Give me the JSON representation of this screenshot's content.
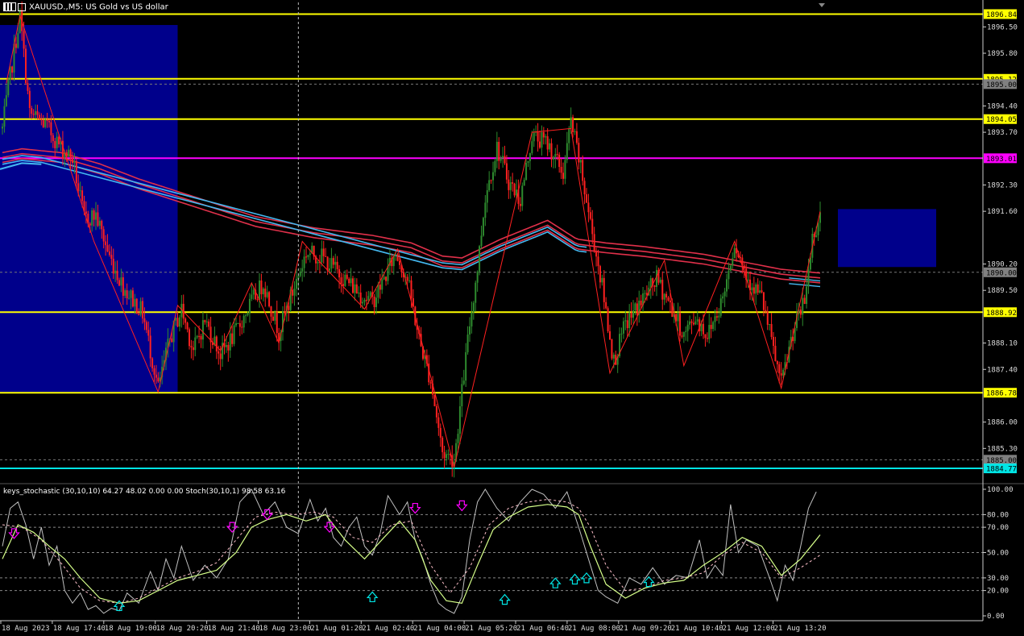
{
  "window": {
    "title": "XAUUSD.,M5:  US Gold vs US dollar"
  },
  "indicator": {
    "title": "keys_stochastic (30,10,10) 64.27 48.02 0.00 0.00 Stoch(30,10,1) 98.58 63.16"
  },
  "colors": {
    "background": "#000000",
    "bull": "#2E8B2E",
    "bear": "#FF2020",
    "zigzag": "#FF2020",
    "ma_red": "#E0304A",
    "ma_blue": "#44B8F0",
    "level_yellow": "#FFFF00",
    "level_magenta": "#FF00FF",
    "level_cyan": "#00E5E5",
    "zone_blue": "#00008B",
    "stoch_main": "#C0C0C0",
    "stoch_signal": "#FFC0CB",
    "stoch_keys": "#D6FF8A",
    "arrow_down": "#FF00FF",
    "arrow_up": "#00E5E5"
  },
  "chart_data": {
    "type": "candlestick",
    "symbol": "XAUUSD.",
    "timeframe": "M5",
    "grid": false,
    "y_ticks": [
      "1896.50",
      "1895.80",
      "1894.40",
      "1893.70",
      "1892.30",
      "1891.60",
      "1890.20",
      "1889.50",
      "1888.10",
      "1887.40",
      "1886.00",
      "1885.30"
    ],
    "ylim": [
      1884.45,
      1897.15
    ],
    "x_ticks": [
      "18 Aug 2023",
      "18 Aug 17:40",
      "18 Aug 19:00",
      "18 Aug 20:20",
      "18 Aug 21:40",
      "18 Aug 23:00",
      "21 Aug 01:20",
      "21 Aug 02:40",
      "21 Aug 04:00",
      "21 Aug 05:20",
      "21 Aug 06:40",
      "21 Aug 08:00",
      "21 Aug 09:20",
      "21 Aug 10:40",
      "21 Aug 12:00",
      "21 Aug 13:20"
    ],
    "price_labels": [
      {
        "text": "1896.84",
        "value": 1896.84,
        "style": "yellow"
      },
      {
        "text": "1895.12",
        "value": 1895.12,
        "style": "yellow"
      },
      {
        "text": "1895.00",
        "value": 1894.98,
        "style": "gray"
      },
      {
        "text": "1894.05",
        "value": 1894.05,
        "style": "yellow"
      },
      {
        "text": "1893.01",
        "value": 1893.01,
        "style": "magenta"
      },
      {
        "text": "1890.00",
        "value": 1889.98,
        "style": "gray"
      },
      {
        "text": "1888.92",
        "value": 1888.92,
        "style": "yellow"
      },
      {
        "text": "1886.78",
        "value": 1886.78,
        "style": "yellow"
      },
      {
        "text": "1885.00",
        "value": 1885.0,
        "style": "gray"
      },
      {
        "text": "1884.77",
        "value": 1884.77,
        "style": "cyan"
      }
    ],
    "horizontal_levels": [
      {
        "value": 1896.84,
        "color": "yellow"
      },
      {
        "value": 1895.12,
        "color": "yellow"
      },
      {
        "value": 1894.05,
        "color": "yellow"
      },
      {
        "value": 1893.01,
        "color": "magenta"
      },
      {
        "value": 1888.92,
        "color": "yellow"
      },
      {
        "value": 1886.78,
        "color": "yellow"
      },
      {
        "value": 1884.77,
        "color": "cyan"
      }
    ],
    "dashed_levels": [
      1894.98,
      1889.98,
      1885.0
    ],
    "zones": [
      {
        "x_start": 0,
        "x_end": 90,
        "y_top": 1896.55,
        "y_bottom": 1886.78
      },
      {
        "x_start": 425,
        "x_end": 510,
        "y_top": 1891.66,
        "y_bottom": 1890.12
      }
    ],
    "vertical_marker_bar": 152,
    "last_bar": 420,
    "anchors": [
      [
        0,
        1893.8
      ],
      [
        4,
        1895.2
      ],
      [
        9,
        1896.8
      ],
      [
        14,
        1894.2
      ],
      [
        22,
        1893.9
      ],
      [
        30,
        1893.3
      ],
      [
        36,
        1893.0
      ],
      [
        42,
        1891.4
      ],
      [
        48,
        1891.5
      ],
      [
        55,
        1890.4
      ],
      [
        62,
        1889.6
      ],
      [
        72,
        1888.9
      ],
      [
        80,
        1886.9
      ],
      [
        86,
        1888.2
      ],
      [
        92,
        1889.0
      ],
      [
        98,
        1887.9
      ],
      [
        104,
        1888.7
      ],
      [
        112,
        1887.8
      ],
      [
        120,
        1888.4
      ],
      [
        128,
        1889.2
      ],
      [
        134,
        1889.7
      ],
      [
        142,
        1888.4
      ],
      [
        150,
        1889.6
      ],
      [
        156,
        1890.5
      ],
      [
        164,
        1890.4
      ],
      [
        170,
        1890.1
      ],
      [
        176,
        1889.8
      ],
      [
        184,
        1889.4
      ],
      [
        190,
        1889.2
      ],
      [
        196,
        1889.8
      ],
      [
        202,
        1890.5
      ],
      [
        208,
        1889.8
      ],
      [
        214,
        1888.2
      ],
      [
        220,
        1887.1
      ],
      [
        226,
        1885.2
      ],
      [
        232,
        1885.0
      ],
      [
        236,
        1886.8
      ],
      [
        240,
        1888.6
      ],
      [
        244,
        1890.1
      ],
      [
        248,
        1892.0
      ],
      [
        254,
        1893.3
      ],
      [
        260,
        1892.4
      ],
      [
        266,
        1891.9
      ],
      [
        272,
        1893.6
      ],
      [
        280,
        1893.4
      ],
      [
        288,
        1892.6
      ],
      [
        292,
        1894.0
      ],
      [
        296,
        1893.0
      ],
      [
        302,
        1891.3
      ],
      [
        308,
        1889.6
      ],
      [
        314,
        1887.6
      ],
      [
        320,
        1888.6
      ],
      [
        328,
        1889.2
      ],
      [
        336,
        1889.8
      ],
      [
        344,
        1889.0
      ],
      [
        350,
        1888.3
      ],
      [
        356,
        1888.8
      ],
      [
        362,
        1888.3
      ],
      [
        370,
        1889.3
      ],
      [
        376,
        1890.8
      ],
      [
        382,
        1889.9
      ],
      [
        390,
        1889.3
      ],
      [
        396,
        1887.9
      ],
      [
        400,
        1887.0
      ],
      [
        406,
        1888.4
      ],
      [
        412,
        1889.2
      ],
      [
        416,
        1890.9
      ],
      [
        420,
        1891.5
      ]
    ],
    "zigzag": [
      [
        2,
        1895.0
      ],
      [
        9,
        1896.8
      ],
      [
        47,
        1890.8
      ],
      [
        80,
        1886.8
      ],
      [
        90,
        1889.1
      ],
      [
        112,
        1887.9
      ],
      [
        128,
        1889.7
      ],
      [
        142,
        1888.1
      ],
      [
        154,
        1890.8
      ],
      [
        164,
        1890.2
      ],
      [
        186,
        1889.0
      ],
      [
        203,
        1890.6
      ],
      [
        232,
        1884.8
      ],
      [
        272,
        1893.7
      ],
      [
        292,
        1893.8
      ],
      [
        312,
        1887.3
      ],
      [
        340,
        1890.3
      ],
      [
        350,
        1887.5
      ],
      [
        376,
        1890.8
      ],
      [
        400,
        1886.9
      ],
      [
        420,
        1891.6
      ]
    ],
    "moving_averages": [
      {
        "color": "red",
        "offset": 0.0
      },
      {
        "color": "red",
        "offset": 0.13
      },
      {
        "color": "red",
        "offset": 0.26
      },
      {
        "color": "blue",
        "offset": -0.05
      },
      {
        "color": "blue",
        "offset": 0.08
      }
    ],
    "ma_anchors": [
      [
        0,
        1892.9
      ],
      [
        10,
        1893.0
      ],
      [
        30,
        1892.9
      ],
      [
        50,
        1892.6
      ],
      [
        70,
        1892.2
      ],
      [
        100,
        1891.7
      ],
      [
        130,
        1891.2
      ],
      [
        160,
        1890.9
      ],
      [
        190,
        1890.7
      ],
      [
        210,
        1890.5
      ],
      [
        226,
        1890.15
      ],
      [
        236,
        1890.1
      ],
      [
        256,
        1890.6
      ],
      [
        280,
        1891.1
      ],
      [
        295,
        1890.6
      ],
      [
        310,
        1890.5
      ],
      [
        330,
        1890.4
      ],
      [
        360,
        1890.2
      ],
      [
        380,
        1890.0
      ],
      [
        400,
        1889.8
      ],
      [
        420,
        1889.7
      ]
    ],
    "indicator_chart": {
      "type": "line",
      "ylim": [
        0,
        100
      ],
      "y_ticks": [
        "100.00",
        "80.00",
        "70.00",
        "50.00",
        "30.00",
        "20.00",
        "0.00"
      ],
      "levels": [
        80,
        70,
        50,
        30,
        20
      ],
      "stoch_main": [
        [
          0,
          55
        ],
        [
          4,
          85
        ],
        [
          8,
          90
        ],
        [
          12,
          72
        ],
        [
          16,
          45
        ],
        [
          20,
          70
        ],
        [
          24,
          40
        ],
        [
          28,
          55
        ],
        [
          32,
          20
        ],
        [
          36,
          10
        ],
        [
          40,
          18
        ],
        [
          44,
          5
        ],
        [
          48,
          8
        ],
        [
          52,
          2
        ],
        [
          56,
          6
        ],
        [
          60,
          4
        ],
        [
          64,
          18
        ],
        [
          70,
          10
        ],
        [
          76,
          35
        ],
        [
          80,
          20
        ],
        [
          84,
          45
        ],
        [
          88,
          30
        ],
        [
          92,
          55
        ],
        [
          98,
          28
        ],
        [
          104,
          40
        ],
        [
          110,
          30
        ],
        [
          116,
          45
        ],
        [
          122,
          90
        ],
        [
          128,
          100
        ],
        [
          134,
          80
        ],
        [
          140,
          90
        ],
        [
          146,
          70
        ],
        [
          152,
          65
        ],
        [
          158,
          92
        ],
        [
          162,
          75
        ],
        [
          166,
          85
        ],
        [
          170,
          62
        ],
        [
          174,
          55
        ],
        [
          178,
          70
        ],
        [
          182,
          78
        ],
        [
          186,
          55
        ],
        [
          190,
          48
        ],
        [
          194,
          65
        ],
        [
          198,
          95
        ],
        [
          204,
          80
        ],
        [
          208,
          90
        ],
        [
          212,
          60
        ],
        [
          216,
          45
        ],
        [
          220,
          25
        ],
        [
          224,
          10
        ],
        [
          228,
          5
        ],
        [
          232,
          2
        ],
        [
          236,
          15
        ],
        [
          240,
          60
        ],
        [
          244,
          90
        ],
        [
          248,
          100
        ],
        [
          254,
          85
        ],
        [
          260,
          75
        ],
        [
          266,
          90
        ],
        [
          272,
          100
        ],
        [
          278,
          96
        ],
        [
          284,
          85
        ],
        [
          290,
          98
        ],
        [
          296,
          70
        ],
        [
          302,
          40
        ],
        [
          306,
          20
        ],
        [
          310,
          15
        ],
        [
          316,
          10
        ],
        [
          322,
          30
        ],
        [
          328,
          25
        ],
        [
          334,
          38
        ],
        [
          340,
          25
        ],
        [
          346,
          32
        ],
        [
          352,
          30
        ],
        [
          358,
          60
        ],
        [
          362,
          30
        ],
        [
          366,
          40
        ],
        [
          370,
          32
        ],
        [
          374,
          88
        ],
        [
          378,
          50
        ],
        [
          382,
          60
        ],
        [
          388,
          55
        ],
        [
          394,
          30
        ],
        [
          398,
          12
        ],
        [
          402,
          40
        ],
        [
          406,
          28
        ],
        [
          410,
          55
        ],
        [
          414,
          85
        ],
        [
          418,
          98
        ]
      ],
      "stoch_signal": [
        [
          0,
          72
        ],
        [
          10,
          70
        ],
        [
          20,
          60
        ],
        [
          30,
          42
        ],
        [
          40,
          22
        ],
        [
          50,
          12
        ],
        [
          60,
          10
        ],
        [
          70,
          14
        ],
        [
          80,
          22
        ],
        [
          90,
          30
        ],
        [
          100,
          35
        ],
        [
          110,
          42
        ],
        [
          120,
          60
        ],
        [
          130,
          78
        ],
        [
          140,
          82
        ],
        [
          150,
          80
        ],
        [
          160,
          82
        ],
        [
          170,
          78
        ],
        [
          180,
          62
        ],
        [
          190,
          58
        ],
        [
          200,
          72
        ],
        [
          210,
          75
        ],
        [
          220,
          40
        ],
        [
          230,
          18
        ],
        [
          240,
          38
        ],
        [
          250,
          72
        ],
        [
          260,
          85
        ],
        [
          270,
          90
        ],
        [
          280,
          92
        ],
        [
          290,
          90
        ],
        [
          296,
          85
        ],
        [
          302,
          70
        ],
        [
          310,
          40
        ],
        [
          320,
          20
        ],
        [
          330,
          22
        ],
        [
          340,
          28
        ],
        [
          350,
          30
        ],
        [
          360,
          34
        ],
        [
          370,
          48
        ],
        [
          380,
          58
        ],
        [
          390,
          50
        ],
        [
          400,
          30
        ],
        [
          410,
          38
        ],
        [
          420,
          48
        ]
      ],
      "stoch_keys": [
        [
          0,
          45
        ],
        [
          8,
          72
        ],
        [
          16,
          66
        ],
        [
          24,
          55
        ],
        [
          32,
          45
        ],
        [
          40,
          30
        ],
        [
          50,
          14
        ],
        [
          60,
          10
        ],
        [
          70,
          12
        ],
        [
          80,
          20
        ],
        [
          90,
          28
        ],
        [
          100,
          32
        ],
        [
          110,
          36
        ],
        [
          120,
          50
        ],
        [
          128,
          70
        ],
        [
          136,
          76
        ],
        [
          146,
          80
        ],
        [
          156,
          75
        ],
        [
          166,
          80
        ],
        [
          176,
          60
        ],
        [
          186,
          45
        ],
        [
          196,
          62
        ],
        [
          204,
          75
        ],
        [
          212,
          60
        ],
        [
          220,
          28
        ],
        [
          228,
          12
        ],
        [
          236,
          10
        ],
        [
          244,
          40
        ],
        [
          252,
          68
        ],
        [
          260,
          78
        ],
        [
          270,
          86
        ],
        [
          280,
          88
        ],
        [
          290,
          86
        ],
        [
          296,
          80
        ],
        [
          302,
          55
        ],
        [
          310,
          25
        ],
        [
          320,
          14
        ],
        [
          330,
          22
        ],
        [
          340,
          26
        ],
        [
          350,
          28
        ],
        [
          360,
          40
        ],
        [
          370,
          50
        ],
        [
          380,
          62
        ],
        [
          390,
          55
        ],
        [
          400,
          32
        ],
        [
          410,
          45
        ],
        [
          420,
          64
        ]
      ],
      "arrows_down": [
        [
          6,
          65
        ],
        [
          118,
          70
        ],
        [
          136,
          80
        ],
        [
          168,
          70
        ],
        [
          212,
          85
        ],
        [
          236,
          87
        ]
      ],
      "arrows_up": [
        [
          60,
          8
        ],
        [
          190,
          15
        ],
        [
          258,
          13
        ],
        [
          284,
          26
        ],
        [
          294,
          29
        ],
        [
          300,
          30
        ],
        [
          332,
          27
        ]
      ]
    }
  }
}
